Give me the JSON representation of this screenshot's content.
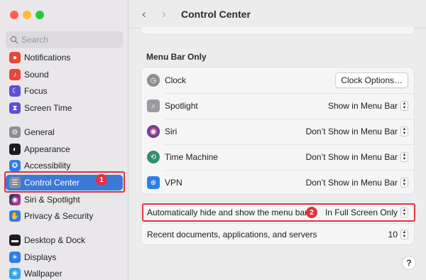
{
  "search": {
    "placeholder": "Search"
  },
  "sidebar": {
    "items": [
      {
        "label": "Notifications"
      },
      {
        "label": "Sound"
      },
      {
        "label": "Focus"
      },
      {
        "label": "Screen Time"
      },
      {
        "label": "General"
      },
      {
        "label": "Appearance"
      },
      {
        "label": "Accessibility"
      },
      {
        "label": "Control Center"
      },
      {
        "label": "Siri & Spotlight"
      },
      {
        "label": "Privacy & Security"
      },
      {
        "label": "Desktop & Dock"
      },
      {
        "label": "Displays"
      },
      {
        "label": "Wallpaper"
      }
    ],
    "selected": "Control Center"
  },
  "annotations": {
    "badge1": "1",
    "badge2": "2",
    "color": "#e0333f"
  },
  "header": {
    "title": "Control Center",
    "back": "‹",
    "forward": "›"
  },
  "section": {
    "title": "Menu Bar Only"
  },
  "menubar_items": [
    {
      "label": "Clock",
      "icon": "clock-icon",
      "button": "Clock Options…"
    },
    {
      "label": "Spotlight",
      "icon": "spotlight-icon",
      "value": "Show in Menu Bar"
    },
    {
      "label": "Siri",
      "icon": "siri-icon",
      "value": "Don’t Show in Menu Bar"
    },
    {
      "label": "Time Machine",
      "icon": "time-machine-icon",
      "value": "Don’t Show in Menu Bar"
    },
    {
      "label": "VPN",
      "icon": "vpn-icon",
      "value": "Don’t Show in Menu Bar"
    }
  ],
  "settings": {
    "autohide_label": "Automatically hide and show the menu bar",
    "autohide_value": "In Full Screen Only",
    "recent_label": "Recent documents, applications, and servers",
    "recent_value": "10"
  },
  "help": "?",
  "colors": {
    "accent": "#3b79d8",
    "close": "#fe5f57",
    "minimize": "#febc2e",
    "zoom": "#28c840"
  }
}
